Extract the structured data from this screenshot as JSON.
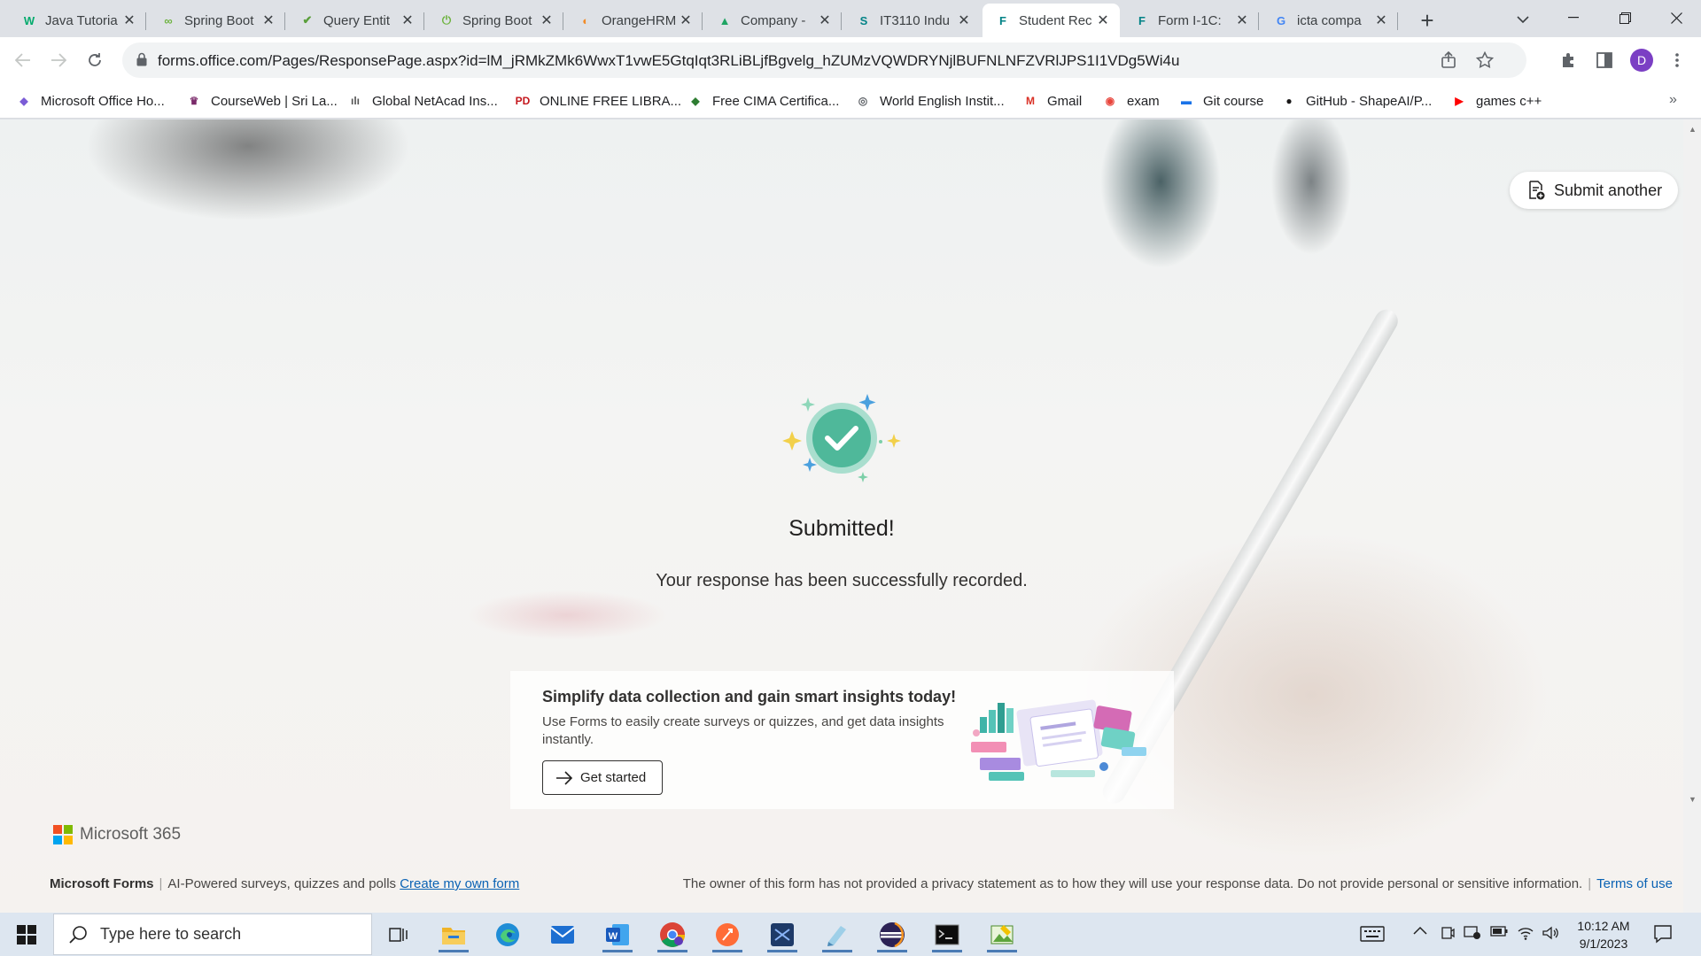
{
  "browser": {
    "tabs": [
      {
        "title": "Java Tutoria",
        "icon": "w3schools-icon",
        "color": "#04aa6d",
        "glyph": "W"
      },
      {
        "title": "Spring Boot",
        "icon": "spring-boot-icon",
        "color": "#6db33f",
        "glyph": "∞"
      },
      {
        "title": "Query Entit",
        "icon": "spring-leaf-icon",
        "color": "#5a9f3c",
        "glyph": "✔"
      },
      {
        "title": "Spring Boot",
        "icon": "spring-power-icon",
        "color": "#6db33f",
        "glyph": "⏻"
      },
      {
        "title": "OrangeHRM",
        "icon": "orangehrm-icon",
        "color": "#f28c28",
        "glyph": "◐"
      },
      {
        "title": "Company -",
        "icon": "google-drive-icon",
        "color": "#1fa463",
        "glyph": "▲"
      },
      {
        "title": "IT3110 Indu",
        "icon": "sharepoint-icon",
        "color": "#038387",
        "glyph": "S"
      },
      {
        "title": "Student Rec",
        "icon": "forms-icon",
        "color": "#038387",
        "glyph": "F",
        "active": true
      },
      {
        "title": "Form I-1C:",
        "icon": "forms-icon",
        "color": "#038387",
        "glyph": "F"
      },
      {
        "title": "icta compa",
        "icon": "google-icon",
        "color": "#4285f4",
        "glyph": "G"
      }
    ],
    "url": "forms.office.com/Pages/ResponsePage.aspx?id=lM_jRMkZMk6WwxT1vwE5GtqIqt3RLiBLjfBgvelg_hZUMzVQWDRYNjlBUFNLNFZVRlJPS1I1VDg5Wi4u",
    "profile_initial": "D",
    "bookmarks": [
      {
        "label": "Microsoft Office Ho...",
        "icon": "office-icon",
        "color": "#7b5cd6",
        "glyph": "◆"
      },
      {
        "label": "CourseWeb | Sri La...",
        "icon": "courseweb-icon",
        "color": "#7a2a6a",
        "glyph": "♛"
      },
      {
        "label": "Global NetAcad Ins...",
        "icon": "cisco-icon",
        "color": "#555555",
        "glyph": "ılı"
      },
      {
        "label": "ONLINE FREE LIBRA...",
        "icon": "pdf-icon",
        "color": "#c4161c",
        "glyph": "PD"
      },
      {
        "label": "Free CIMA Certifica...",
        "icon": "cima-icon",
        "color": "#2e7d32",
        "glyph": "◆"
      },
      {
        "label": "World English Instit...",
        "icon": "globe-icon",
        "color": "#5f6368",
        "glyph": "◎"
      },
      {
        "label": "Gmail",
        "icon": "gmail-icon",
        "color": "#d93025",
        "glyph": "M"
      },
      {
        "label": "exam",
        "icon": "exam-icon",
        "color": "#e8453c",
        "glyph": "◉"
      },
      {
        "label": "Git course",
        "icon": "document-icon",
        "color": "#1a73e8",
        "glyph": "▬"
      },
      {
        "label": "GitHub - ShapeAI/P...",
        "icon": "github-icon",
        "color": "#181717",
        "glyph": "●"
      },
      {
        "label": "games c++",
        "icon": "youtube-icon",
        "color": "#ff0000",
        "glyph": "▶"
      }
    ]
  },
  "page": {
    "submit_another": "Submit another",
    "submitted_title": "Submitted!",
    "submitted_message": "Your response has been successfully recorded.",
    "promo": {
      "title": "Simplify data collection and gain smart insights today!",
      "body": "Use Forms to easily create surveys or quizzes, and get data insights instantly.",
      "button": "Get started"
    },
    "brand": "Microsoft 365",
    "footer": {
      "product": "Microsoft Forms",
      "tagline": "AI-Powered surveys, quizzes and polls",
      "create_link": "Create my own form",
      "privacy": "The owner of this form has not provided a privacy statement as to how they will use your response data. Do not provide personal or sensitive information.",
      "terms": "Terms of use"
    },
    "colors": {
      "success": "#4fb89a",
      "link": "#0a62b4"
    }
  },
  "taskbar": {
    "search_placeholder": "Type here to search",
    "apps": [
      "task-view-icon",
      "file-explorer-icon",
      "edge-icon",
      "mail-icon",
      "word-icon",
      "chrome-icon",
      "postman-icon",
      "visual-studio-icon",
      "notepad-icon",
      "eclipse-icon",
      "terminal-icon",
      "image-editor-icon"
    ],
    "time": "10:12 AM",
    "date": "9/1/2023"
  }
}
